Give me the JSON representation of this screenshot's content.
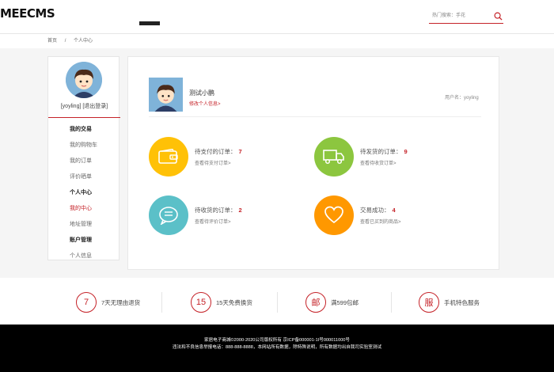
{
  "header": {
    "logo": "MEECMS",
    "search_label": "热门搜索：手花"
  },
  "breadcrumb": {
    "home": "首页",
    "sep": "/",
    "current": "个人中心"
  },
  "sidebar": {
    "user_line": "[yoyling] [退出登录]",
    "items": [
      {
        "label": "我的交易",
        "type": "group"
      },
      {
        "label": "我的购物车",
        "type": "item"
      },
      {
        "label": "我的订单",
        "type": "item"
      },
      {
        "label": "评价晒单",
        "type": "item"
      },
      {
        "label": "个人中心",
        "type": "group"
      },
      {
        "label": "我的中心",
        "type": "active"
      },
      {
        "label": "地址管理",
        "type": "item"
      },
      {
        "label": "账户管理",
        "type": "group"
      },
      {
        "label": "个人信息",
        "type": "item"
      }
    ]
  },
  "profile": {
    "name": "测试小鹏",
    "edit_link": "修改个人信息>",
    "username_field": "用户名：yoyling"
  },
  "tiles": [
    {
      "title": "待支付的订单：",
      "count": "7",
      "link": "查看待支付订单>",
      "color": "#ffc107",
      "icon": "wallet-icon"
    },
    {
      "title": "待发货的订单：",
      "count": "9",
      "link": "查看待收货订单>",
      "color": "#8cc63f",
      "icon": "truck-icon"
    },
    {
      "title": "待收货的订单：",
      "count": "2",
      "link": "查看待评价订单>",
      "color": "#5bc0c8",
      "icon": "chat-icon"
    },
    {
      "title": "交易成功：",
      "count": "4",
      "link": "查看已买到的商品>",
      "color": "#ff9800",
      "icon": "heart-icon"
    }
  ],
  "services": [
    {
      "badge": "7",
      "label": "7天无理由退货"
    },
    {
      "badge": "15",
      "label": "15天免费换货"
    },
    {
      "badge": "邮",
      "label": "满599包邮"
    },
    {
      "badge": "服",
      "label": "手机特色服务"
    }
  ],
  "footer": {
    "line1": "家居电子商城©2000-2020公司版权所有 京ICP备000001-1I号000011000号",
    "line2": "违法和不良信息举报电话：888-888-8888，本网站所有数据，除特殊说明，所有数据均出自我司实验室测试"
  },
  "colors": {
    "accent": "#c52228",
    "footer_bg": "#000000",
    "content_bg": "#f5f5f5"
  }
}
